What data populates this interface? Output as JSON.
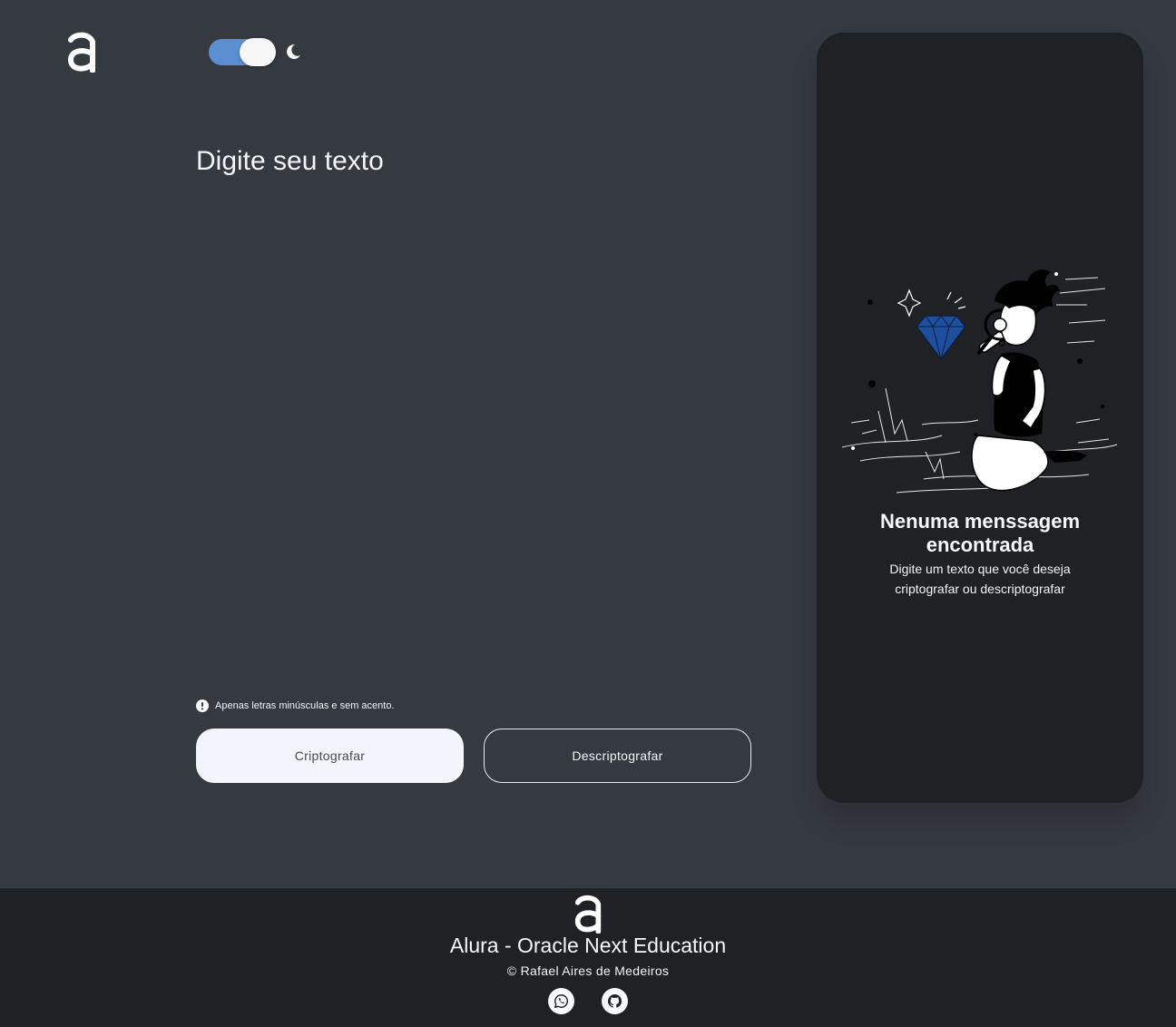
{
  "header": {
    "logo_icon": "alura-logo-icon",
    "theme_toggle": {
      "state": "on",
      "accent": "#5b8fd2",
      "icon": "moon-icon"
    }
  },
  "input": {
    "placeholder": "Digite seu texto",
    "value": ""
  },
  "hint": {
    "icon": "exclamation-circle-icon",
    "text": "Apenas letras minúsculas e sem acento."
  },
  "buttons": {
    "encrypt_label": "Criptografar",
    "decrypt_label": "Descriptografar"
  },
  "output_panel": {
    "illustration": "person-searching-diamond-illustration",
    "title_line1": "Nenuma menssagem",
    "title_line2": "encontrada",
    "subtitle": "Digite um texto que você deseja criptografar ou descriptografar"
  },
  "footer": {
    "logo_icon": "alura-logo-icon",
    "title": "Alura - Oracle Next Education",
    "copyright": "© Rafael Aires de Medeiros",
    "social": [
      {
        "icon": "whatsapp-icon"
      },
      {
        "icon": "github-icon"
      }
    ]
  },
  "colors": {
    "background": "#353940",
    "panel": "#1f2124",
    "footer": "#1f2124",
    "primary_button": "#f3f5fc",
    "text": "#f2f4f8",
    "diamond": "#1e4e9e"
  }
}
